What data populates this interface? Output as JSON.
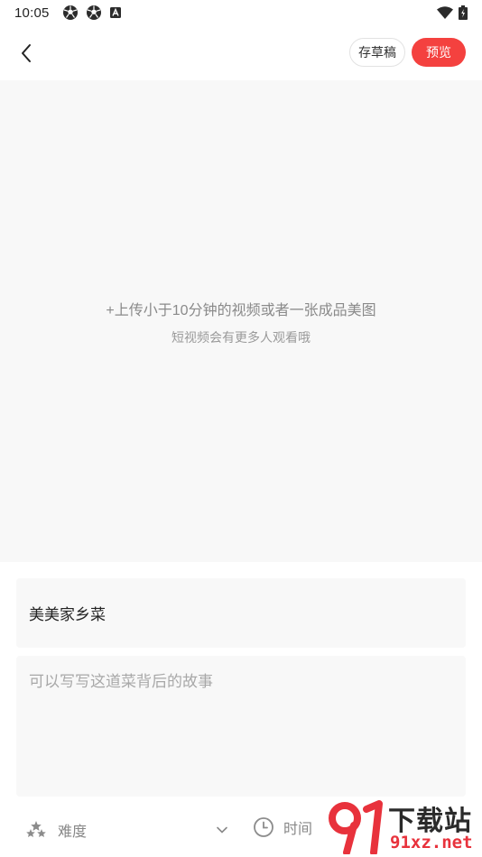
{
  "status_bar": {
    "time": "10:05",
    "left_icons": [
      "soccer-ball-icon",
      "soccer-ball-icon",
      "android-icon"
    ],
    "right_icons": [
      "wifi-icon",
      "battery-icon"
    ]
  },
  "header": {
    "back_icon": "chevron-left-icon",
    "draft_label": "存草稿",
    "preview_label": "预览",
    "accent_color": "#f4413f"
  },
  "upload": {
    "main_text": "+上传小于10分钟的视频或者一张成品美图",
    "sub_text": "短视频会有更多人观看哦"
  },
  "form": {
    "title_value": "美美家乡菜",
    "story_placeholder": "可以写写这道菜背后的故事"
  },
  "attributes": {
    "difficulty_label": "难度",
    "difficulty_icon": "stars-icon",
    "time_label": "时间",
    "time_icon": "clock-icon"
  },
  "watermark": {
    "title": "下载站",
    "domain": "91xz.net"
  }
}
